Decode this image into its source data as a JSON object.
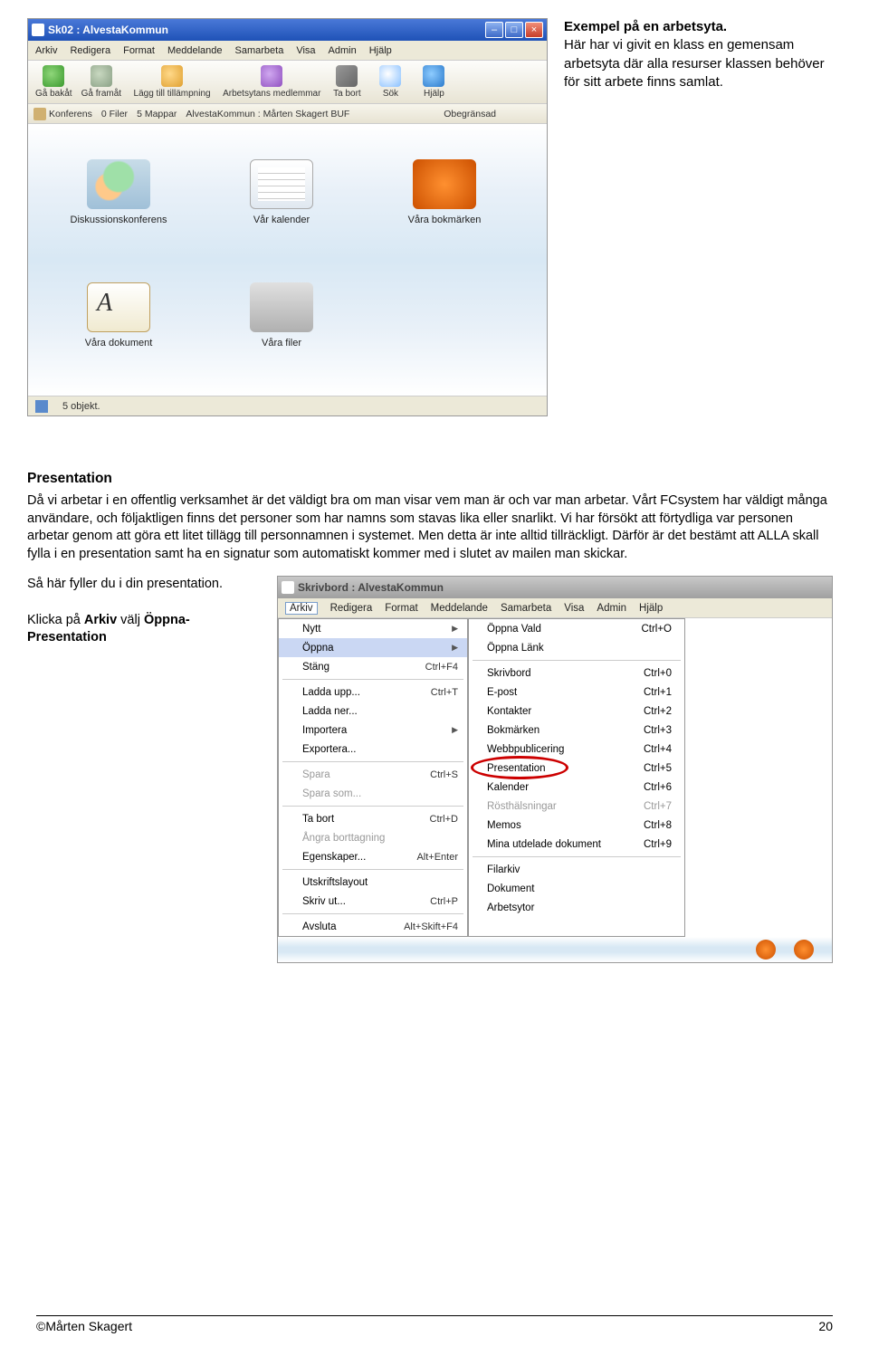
{
  "caption": {
    "title": "Exempel på en arbetsyta.",
    "body": "Här har vi givit en klass en gemensam arbetsyta där alla resurser klassen behöver för sitt arbete finns samlat."
  },
  "scr1": {
    "title": "Sk02 : AlvestaKommun",
    "menu": [
      "Arkiv",
      "Redigera",
      "Format",
      "Meddelande",
      "Samarbeta",
      "Visa",
      "Admin",
      "Hjälp"
    ],
    "toolbar": [
      {
        "label": "Gå bakåt"
      },
      {
        "label": "Gå framåt"
      },
      {
        "label": "Lägg till tillämpning"
      },
      {
        "label": "Arbetsytans medlemmar"
      },
      {
        "label": "Ta bort"
      },
      {
        "label": "Sök"
      },
      {
        "label": "Hjälp"
      }
    ],
    "toolbar2": {
      "a": "Konferens",
      "b": "0 Filer",
      "c": "5 Mappar",
      "d": "AlvestaKommun : Mårten Skagert BUF",
      "e": "Obegränsad"
    },
    "items": [
      {
        "label": "Diskussionskonferens"
      },
      {
        "label": "Vår kalender"
      },
      {
        "label": "Våra bokmärken"
      },
      {
        "label": "Våra dokument"
      },
      {
        "label": "Våra filer"
      }
    ],
    "status": "5 objekt."
  },
  "presentation": {
    "heading": "Presentation",
    "body": "Då vi arbetar i en offentlig verksamhet är det väldigt bra om man visar vem man är och var man arbetar. Vårt FCsystem har väldigt många användare, och följaktligen finns det personer som har namns som stavas lika eller snarlikt. Vi har försökt att förtydliga var personen arbetar genom att göra ett litet tillägg till personnamnen i systemet. Men detta är inte alltid tillräckligt. Därför är det bestämt att ALLA skall fylla i en presentation samt ha en signatur som automatiskt kommer med i slutet av mailen man skickar.",
    "left1": "Så här fyller du i din presentation.",
    "left2_a": "Klicka på ",
    "left2_b": "Arkiv",
    "left2_c": " välj ",
    "left2_d": "Öppna-Presentation"
  },
  "scr2": {
    "title": "Skrivbord : AlvestaKommun",
    "menu": [
      "Arkiv",
      "Redigera",
      "Format",
      "Meddelande",
      "Samarbeta",
      "Visa",
      "Admin",
      "Hjälp"
    ],
    "arkiv": [
      {
        "l": "Nytt",
        "sc": "",
        "arr": true
      },
      {
        "l": "Öppna",
        "sc": "",
        "arr": true,
        "hl": true
      },
      {
        "l": "Stäng",
        "sc": "Ctrl+F4"
      },
      {
        "sep": true
      },
      {
        "l": "Ladda upp...",
        "sc": "Ctrl+T"
      },
      {
        "l": "Ladda ner..."
      },
      {
        "l": "Importera",
        "arr": true
      },
      {
        "l": "Exportera..."
      },
      {
        "sep": true
      },
      {
        "l": "Spara",
        "sc": "Ctrl+S",
        "dis": true
      },
      {
        "l": "Spara som...",
        "dis": true
      },
      {
        "sep": true
      },
      {
        "l": "Ta bort",
        "sc": "Ctrl+D"
      },
      {
        "l": "Ångra borttagning",
        "dis": true
      },
      {
        "l": "Egenskaper...",
        "sc": "Alt+Enter"
      },
      {
        "sep": true
      },
      {
        "l": "Utskriftslayout"
      },
      {
        "l": "Skriv ut...",
        "sc": "Ctrl+P"
      },
      {
        "sep": true
      },
      {
        "l": "Avsluta",
        "sc": "Alt+Skift+F4"
      }
    ],
    "submenu": [
      {
        "l": "Öppna Vald",
        "sc": "Ctrl+O"
      },
      {
        "l": "Öppna Länk"
      },
      {
        "sep": true
      },
      {
        "l": "Skrivbord",
        "sc": "Ctrl+0"
      },
      {
        "l": "E-post",
        "sc": "Ctrl+1"
      },
      {
        "l": "Kontakter",
        "sc": "Ctrl+2"
      },
      {
        "l": "Bokmärken",
        "sc": "Ctrl+3"
      },
      {
        "l": "Webbpublicering",
        "sc": "Ctrl+4"
      },
      {
        "l": "Presentation",
        "sc": "Ctrl+5",
        "circle": true
      },
      {
        "l": "Kalender",
        "sc": "Ctrl+6"
      },
      {
        "l": "Rösthälsningar",
        "sc": "Ctrl+7",
        "dis": true
      },
      {
        "l": "Memos",
        "sc": "Ctrl+8"
      },
      {
        "l": "Mina utdelade dokument",
        "sc": "Ctrl+9"
      },
      {
        "sep": true
      },
      {
        "l": "Filarkiv"
      },
      {
        "l": "Dokument"
      },
      {
        "l": "Arbetsytor"
      }
    ]
  },
  "footer": {
    "author": "©Mårten Skagert",
    "page": "20"
  }
}
